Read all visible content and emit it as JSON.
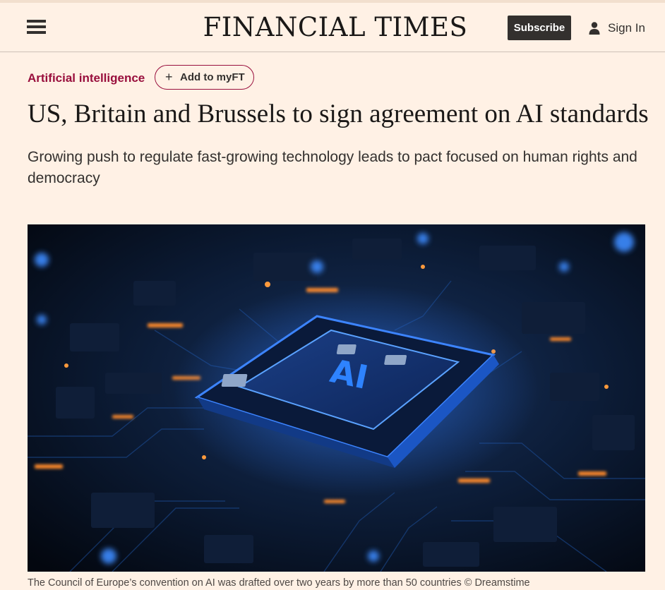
{
  "header": {
    "masthead": "FINANCIAL TIMES",
    "subscribe_label": "Subscribe",
    "signin_label": "Sign In",
    "menu_icon": "hamburger-menu-icon",
    "user_icon": "user-icon"
  },
  "article": {
    "topic": "Artificial intelligence",
    "myft_label": "Add to myFT",
    "myft_icon": "plus-icon",
    "headline": "US, Britain and Brussels to sign agreement on AI standards",
    "standfirst": "Growing push to regulate fast-growing technology leads to pact focused on human rights and democracy",
    "image": {
      "chip_label": "AI"
    },
    "caption": "The Council of Europe’s convention on AI was drafted over two years by more than 50 countries © Dreamstime"
  },
  "colors": {
    "background": "#fff1e5",
    "accent": "#990f3d",
    "button_dark": "#33302e",
    "text": "#33302e"
  }
}
